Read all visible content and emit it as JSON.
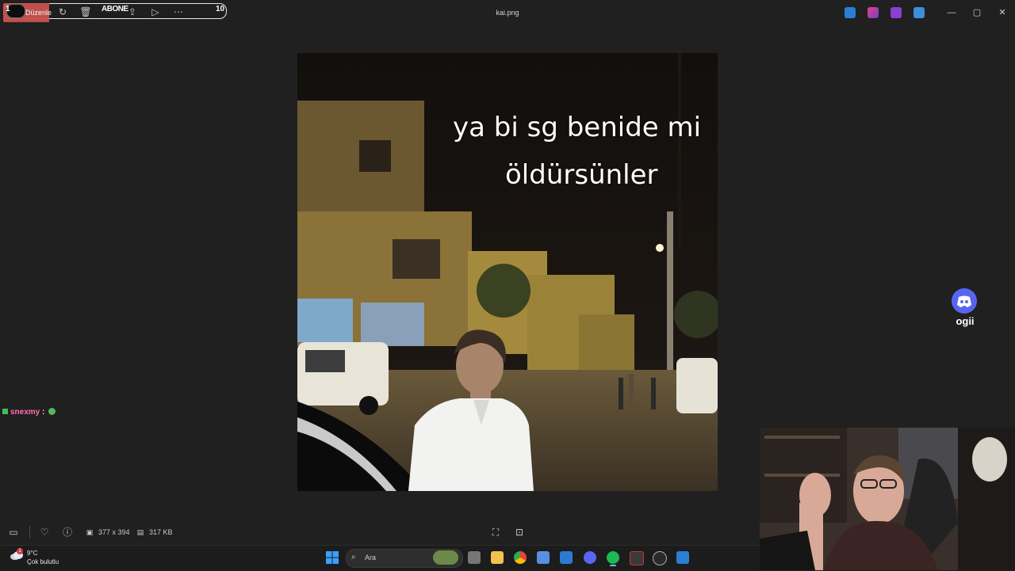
{
  "window": {
    "title": "kai.png",
    "edit_label": "Düzenle",
    "controls": [
      "minimize",
      "maximize",
      "close"
    ]
  },
  "stream_overlay": {
    "subscribe_label": "ABONE",
    "count_left": "1",
    "count_right": "10",
    "subscribe_progress": 0.1
  },
  "image": {
    "caption_line1": "ya bi sg benide mi",
    "caption_line2": "öldürsünler"
  },
  "chat": {
    "username": "snexmy",
    "separator": ":"
  },
  "discord": {
    "name": "ogii"
  },
  "statusbar": {
    "dimensions": "377 x 394",
    "file_size": "317 KB"
  },
  "taskbar": {
    "temperature": "9°C",
    "weather": "Çok bulutlu",
    "alert_count": "1",
    "search_placeholder": "Ara",
    "apps": [
      "file-explorer",
      "chrome",
      "store",
      "mail",
      "discord",
      "spotify",
      "obs",
      "steam",
      "paint"
    ],
    "active_app": "spotify"
  },
  "colors": {
    "accent": "#5865f2",
    "progress": "#c8524f",
    "chat_user": "#ff6fae"
  }
}
